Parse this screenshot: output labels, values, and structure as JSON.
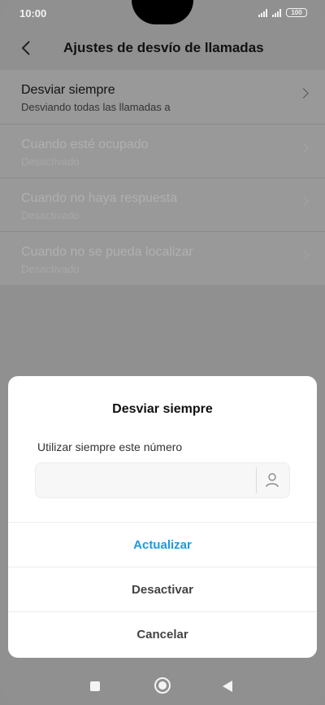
{
  "status_bar": {
    "time": "10:00",
    "battery": "100",
    "icons": [
      "signal-icon",
      "signal-icon",
      "battery-icon"
    ]
  },
  "header": {
    "title": "Ajustes de desvío de llamadas",
    "back_icon": "back-arrow-icon"
  },
  "settings": {
    "items": [
      {
        "title": "Desviar siempre",
        "subtitle": "Desviando todas las llamadas a"
      },
      {
        "title": "Cuando esté ocupado",
        "subtitle": "Desactivado"
      },
      {
        "title": "Cuando no haya respuesta",
        "subtitle": "Desactivado"
      },
      {
        "title": "Cuando no se pueda localizar",
        "subtitle": "Desactivado"
      }
    ]
  },
  "dialog": {
    "title": "Desviar siempre",
    "label": "Utilizar siempre este número",
    "input_value": "",
    "input_placeholder": "",
    "contact_icon": "contact-person-icon",
    "update_label": "Actualizar",
    "deactivate_label": "Desactivar",
    "cancel_label": "Cancelar",
    "accent_color": "#1a9be0"
  },
  "nav_bar": {
    "icons": [
      "recent-apps-icon",
      "home-icon",
      "back-icon"
    ]
  }
}
